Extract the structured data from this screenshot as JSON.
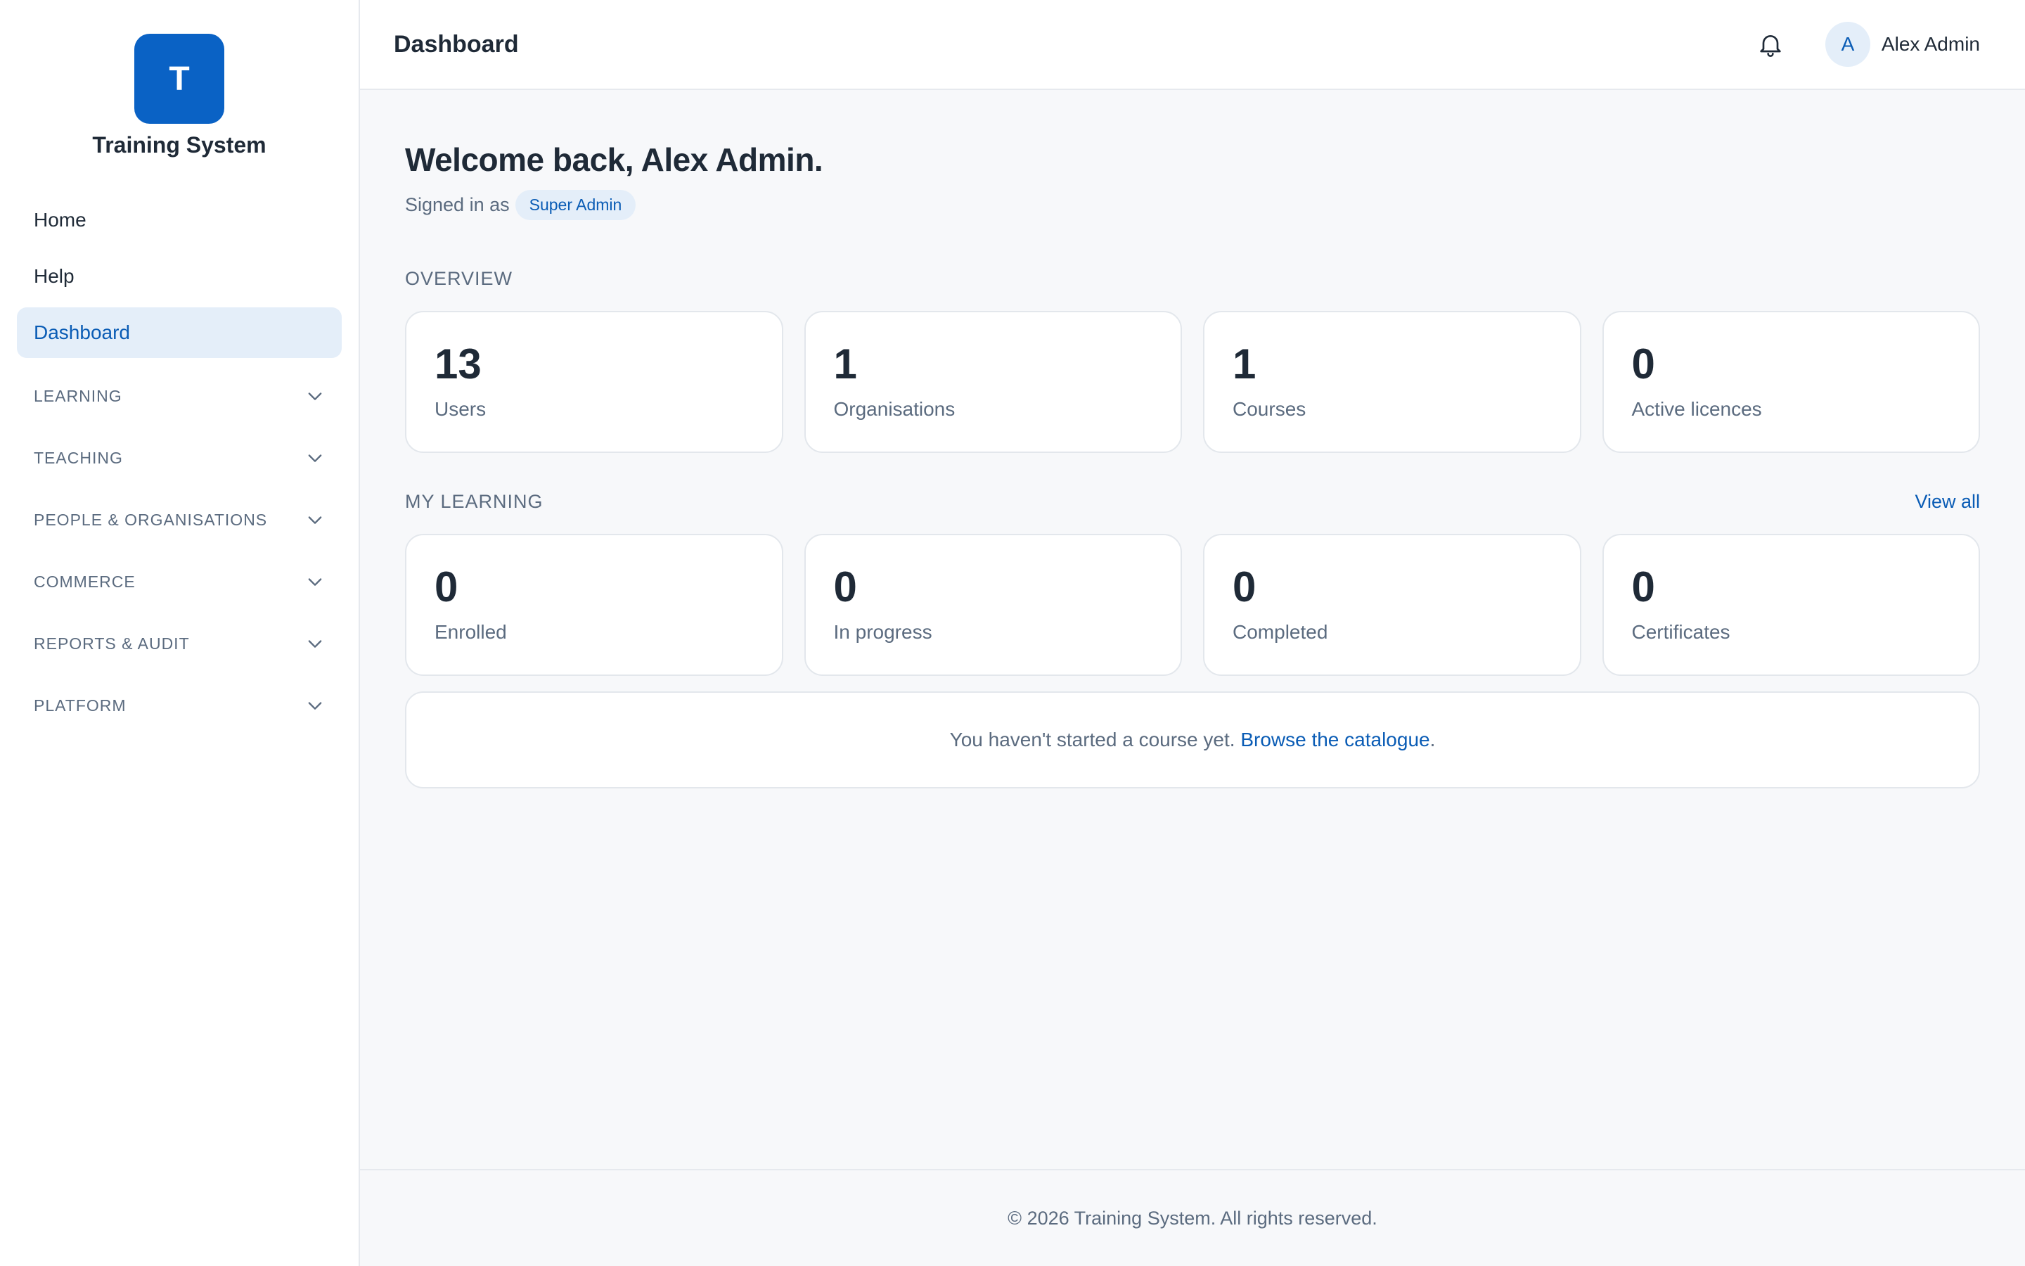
{
  "sidebar": {
    "logo_letter": "T",
    "brand_name": "Training System",
    "nav_items": [
      {
        "label": "Home"
      },
      {
        "label": "Help"
      },
      {
        "label": "Dashboard"
      }
    ],
    "sections": [
      {
        "label": "LEARNING"
      },
      {
        "label": "TEACHING"
      },
      {
        "label": "PEOPLE & ORGANISATIONS"
      },
      {
        "label": "COMMERCE"
      },
      {
        "label": "REPORTS & AUDIT"
      },
      {
        "label": "PLATFORM"
      }
    ],
    "active_item": "Dashboard"
  },
  "header": {
    "title": "Dashboard",
    "avatar_initial": "A",
    "user_name": "Alex Admin"
  },
  "main": {
    "welcome": "Welcome back, Alex Admin.",
    "signed_in_prefix": "Signed in as",
    "role_badge": "Super Admin",
    "overview_title": "OVERVIEW",
    "overview_cards": [
      {
        "value": "13",
        "label": "Users"
      },
      {
        "value": "1",
        "label": "Organisations"
      },
      {
        "value": "1",
        "label": "Courses"
      },
      {
        "value": "0",
        "label": "Active licences"
      }
    ],
    "learning_title": "MY LEARNING",
    "view_all": "View all",
    "learning_cards": [
      {
        "value": "0",
        "label": "Enrolled"
      },
      {
        "value": "0",
        "label": "In progress"
      },
      {
        "value": "0",
        "label": "Completed"
      },
      {
        "value": "0",
        "label": "Certificates"
      }
    ],
    "empty_text": "You haven't started a course yet.",
    "empty_link": "Browse the catalogue",
    "empty_suffix": "."
  },
  "footer": {
    "text": "© 2026 Training System. All rights reserved."
  },
  "colors": {
    "accent": "#0a62c5",
    "link": "#0a5cb5",
    "active_bg": "#e4eef9",
    "page_bg": "#f7f8fa"
  },
  "icons": {
    "bell": "bell-icon",
    "chevron": "chevron-down-icon"
  }
}
